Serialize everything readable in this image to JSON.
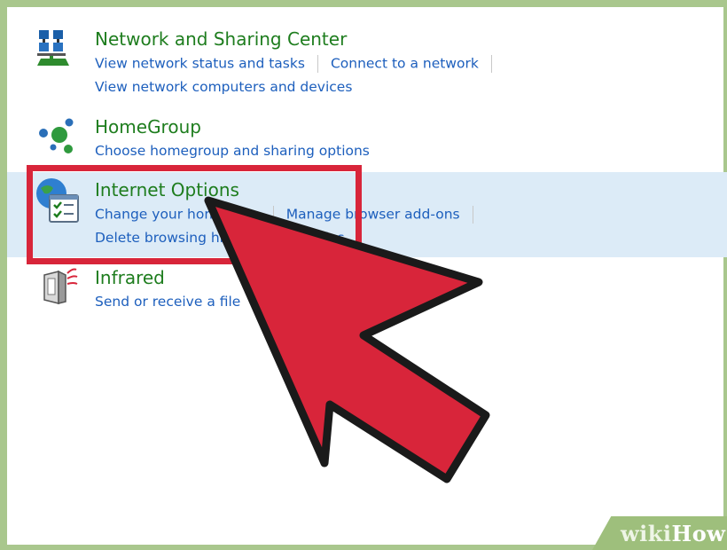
{
  "categories": {
    "network": {
      "title": "Network and Sharing Center",
      "link_view_status": "View network status and tasks",
      "link_connect": "Connect to a network",
      "link_view_computers": "View network computers and devices"
    },
    "homegroup": {
      "title": "HomeGroup",
      "link_choose": "Choose homegroup and sharing options"
    },
    "internet_options": {
      "title": "Internet Options",
      "link_change_homepage": "Change your homepage",
      "link_manage_addons": "Manage browser add-ons",
      "link_delete_history": "Delete browsing history and cookies"
    },
    "infrared": {
      "title": "Infrared",
      "link_send_receive": "Send or receive a file"
    }
  },
  "icons": {
    "network": "network-sharing-icon",
    "homegroup": "homegroup-icon",
    "internet_options": "internet-options-icon",
    "infrared": "infrared-icon"
  },
  "watermark": {
    "part1": "wiki",
    "part2": "How"
  },
  "colors": {
    "title_green": "#1e7d1e",
    "link_blue": "#1d5fbd",
    "selection": "#dcebf7",
    "callout_red": "#d8253a",
    "frame_green": "#a9c78d"
  }
}
